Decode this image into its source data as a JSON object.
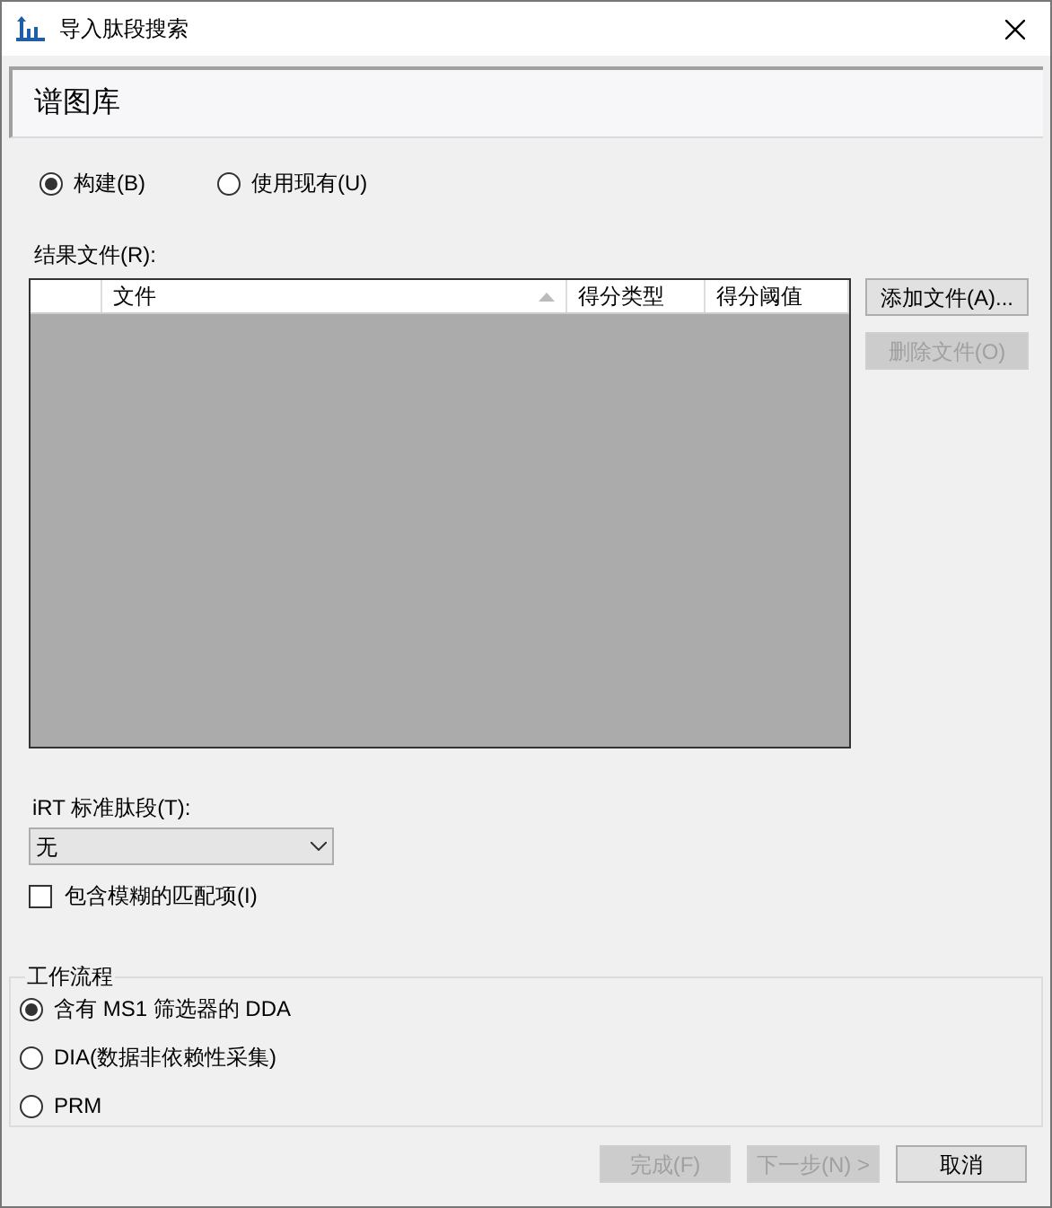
{
  "window": {
    "title": "导入肽段搜索"
  },
  "page_heading": "谱图库",
  "library_modes": [
    {
      "label": "构建(B)",
      "selected": true
    },
    {
      "label": "使用现有(U)",
      "selected": false
    }
  ],
  "result_files": {
    "label": "结果文件(R):",
    "columns": [
      {
        "label": "文件",
        "sorted": true
      },
      {
        "label": "得分类型",
        "sorted": false
      },
      {
        "label": "得分阈值",
        "sorted": false
      }
    ]
  },
  "file_buttons": [
    {
      "label": "添加文件(A)...",
      "disabled": false
    },
    {
      "label": "删除文件(O)",
      "disabled": true
    }
  ],
  "irt": {
    "label": "iRT 标准肽段(T):",
    "value": "无"
  },
  "include_ambiguous": {
    "label": "包含模糊的匹配项(I)",
    "checked": false
  },
  "workflow": {
    "title": "工作流程",
    "options": [
      {
        "label": "含有 MS1 筛选器的 DDA",
        "selected": true
      },
      {
        "label": "DIA(数据非依赖性采集)",
        "selected": false
      },
      {
        "label": "PRM",
        "selected": false
      }
    ]
  },
  "footer_buttons": [
    {
      "label": "完成(F)",
      "disabled": true
    },
    {
      "label": "下一步(N) >",
      "disabled": true
    },
    {
      "label": "取消",
      "disabled": false
    }
  ]
}
